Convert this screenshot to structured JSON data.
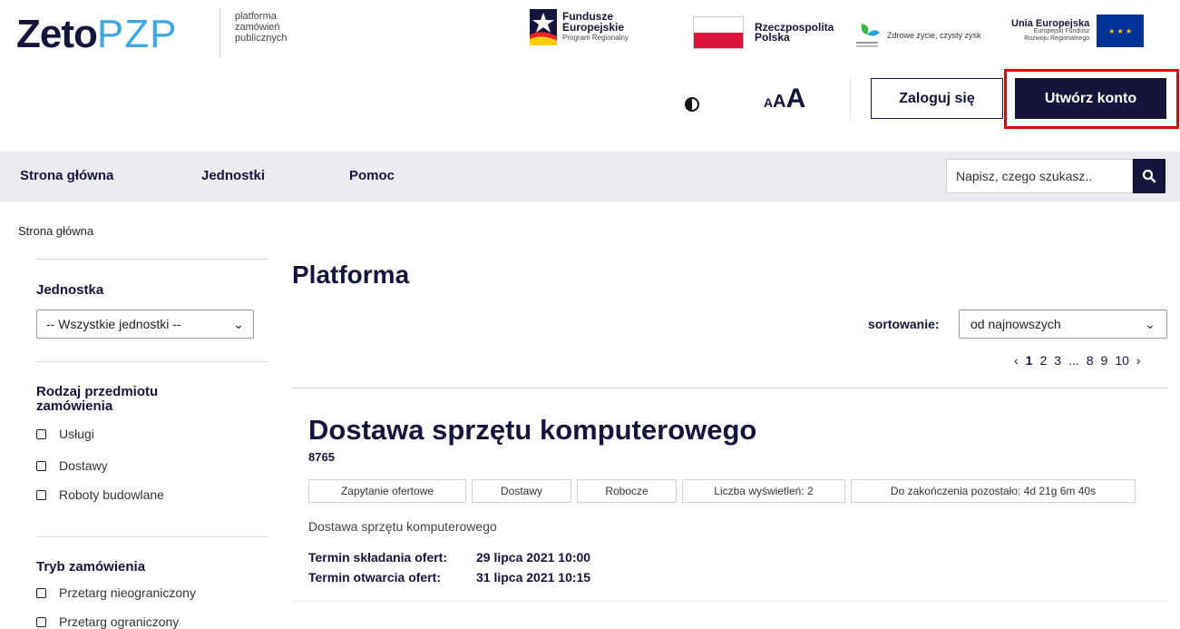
{
  "brand": {
    "name_main": "Zeto",
    "name_accent": "PZP",
    "subtitle": [
      "platforma",
      "zamówień",
      "publicznych"
    ]
  },
  "partners": {
    "fe_title": [
      "Fundusze",
      "Europejskie"
    ],
    "fe_sub": "Program Regionalny",
    "pl_title": [
      "Rzeczpospolita",
      "Polska"
    ],
    "eco_text": "Zdrowe życie, czysty zysk",
    "ue_title": "Unia Europejska",
    "ue_sub": [
      "Europejski Fundusz",
      "Rozwoju Regionalnego"
    ]
  },
  "tools": {
    "font_small": "A",
    "font_mid": "A",
    "font_large": "A",
    "login_label": "Zaloguj się",
    "create_label": "Utwórz konto"
  },
  "nav": {
    "items": [
      "Strona główna",
      "Jednostki",
      "Pomoc"
    ],
    "search_placeholder": "Napisz, czego szukasz.."
  },
  "breadcrumb": "Strona główna",
  "sidebar": {
    "unit_heading": "Jednostka",
    "unit_select": "-- Wszystkie jednostki --",
    "type_heading": "Rodzaj przedmiotu zamówienia",
    "types": [
      "Usługi",
      "Dostawy",
      "Roboty budowlane"
    ],
    "mode_heading": "Tryb zamówienia",
    "modes": [
      "Przetarg nieograniczony",
      "Przetarg ograniczony"
    ]
  },
  "main": {
    "title": "Platforma",
    "sort_label": "sortowanie:",
    "sort_value": "od najnowszych",
    "pager": {
      "prev": "‹",
      "pages": [
        "1",
        "2",
        "3",
        "...",
        "8",
        "9",
        "10"
      ],
      "next": "›"
    }
  },
  "card": {
    "title": "Dostawa sprzętu komputerowego",
    "id": "8765",
    "tags": [
      "Zapytanie ofertowe",
      "Dostawy",
      "Robocze",
      "Liczba wyświetleń: 2",
      "Do zakończenia pozostało: 4d 21g 6m 40s"
    ],
    "description": "Dostawa sprzętu komputerowego",
    "term_submit_label": "Termin składania ofert:",
    "term_submit_value": "29 lipca 2021 10:00",
    "term_open_label": "Termin otwarcia ofert:",
    "term_open_value": "31 lipca 2021 10:15"
  },
  "colors": {
    "navy": "#14143c",
    "accent": "#3da9e0",
    "highlight": "#e00000",
    "nav_bg": "#ececf0"
  }
}
